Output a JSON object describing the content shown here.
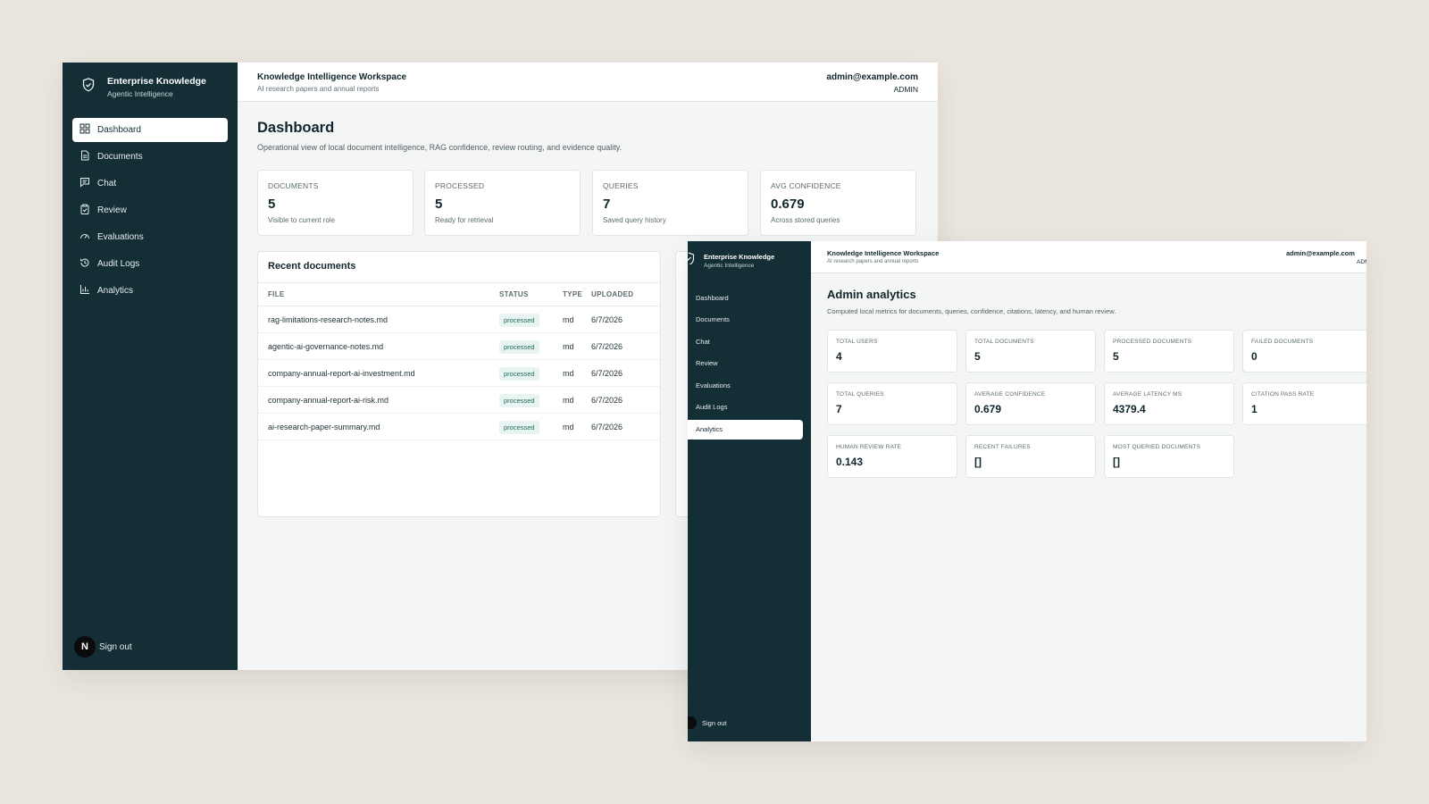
{
  "brand": {
    "name": "Enterprise Knowledge",
    "subtitle": "Agentic Intelligence"
  },
  "workspace": {
    "title": "Knowledge Intelligence Workspace",
    "subtitle": "AI research papers and annual reports"
  },
  "account": {
    "email": "admin@example.com",
    "role": "ADMIN"
  },
  "nav": {
    "items": [
      {
        "label": "Dashboard",
        "icon": "dashboard-grid-icon"
      },
      {
        "label": "Documents",
        "icon": "document-icon"
      },
      {
        "label": "Chat",
        "icon": "chat-icon"
      },
      {
        "label": "Review",
        "icon": "clipboard-check-icon"
      },
      {
        "label": "Evaluations",
        "icon": "gauge-icon"
      },
      {
        "label": "Audit Logs",
        "icon": "history-icon"
      },
      {
        "label": "Analytics",
        "icon": "bar-chart-icon"
      }
    ],
    "sign_out": "Sign out",
    "badge_letter": "N"
  },
  "dashboard": {
    "title": "Dashboard",
    "description": "Operational view of local document intelligence, RAG confidence, review routing, and evidence quality.",
    "stats": [
      {
        "label": "DOCUMENTS",
        "value": "5",
        "sub": "Visible to current role"
      },
      {
        "label": "PROCESSED",
        "value": "5",
        "sub": "Ready for retrieval"
      },
      {
        "label": "QUERIES",
        "value": "7",
        "sub": "Saved query history"
      },
      {
        "label": "AVG CONFIDENCE",
        "value": "0.679",
        "sub": "Across stored queries"
      }
    ],
    "recent": {
      "title": "Recent documents",
      "columns": [
        "FILE",
        "STATUS",
        "TYPE",
        "UPLOADED"
      ],
      "rows": [
        {
          "file": "rag-limitations-research-notes.md",
          "status": "processed",
          "type": "md",
          "uploaded": "6/7/2026"
        },
        {
          "file": "agentic-ai-governance-notes.md",
          "status": "processed",
          "type": "md",
          "uploaded": "6/7/2026"
        },
        {
          "file": "company-annual-report-ai-investment.md",
          "status": "processed",
          "type": "md",
          "uploaded": "6/7/2026"
        },
        {
          "file": "company-annual-report-ai-risk.md",
          "status": "processed",
          "type": "md",
          "uploaded": "6/7/2026"
        },
        {
          "file": "ai-research-paper-summary.md",
          "status": "processed",
          "type": "md",
          "uploaded": "6/7/2026"
        }
      ]
    }
  },
  "analytics": {
    "title": "Admin analytics",
    "description": "Computed local metrics for documents, queries, confidence, citations, latency, and human review.",
    "metrics": [
      {
        "label": "TOTAL USERS",
        "value": "4"
      },
      {
        "label": "TOTAL DOCUMENTS",
        "value": "5"
      },
      {
        "label": "PROCESSED DOCUMENTS",
        "value": "5"
      },
      {
        "label": "FAILED DOCUMENTS",
        "value": "0"
      },
      {
        "label": "TOTAL QUERIES",
        "value": "7"
      },
      {
        "label": "AVERAGE CONFIDENCE",
        "value": "0.679"
      },
      {
        "label": "AVERAGE LATENCY MS",
        "value": "4379.4"
      },
      {
        "label": "CITATION PASS RATE",
        "value": "1"
      },
      {
        "label": "HUMAN REVIEW RATE",
        "value": "0.143"
      },
      {
        "label": "RECENT FAILURES",
        "value": "[]"
      },
      {
        "label": "MOST QUERIED DOCUMENTS",
        "value": "[]"
      }
    ]
  },
  "colors": {
    "sidebar": "#132e35",
    "background": "#ebe6df",
    "pill_bg": "#e8f4f1",
    "pill_text": "#1f6a5c"
  }
}
